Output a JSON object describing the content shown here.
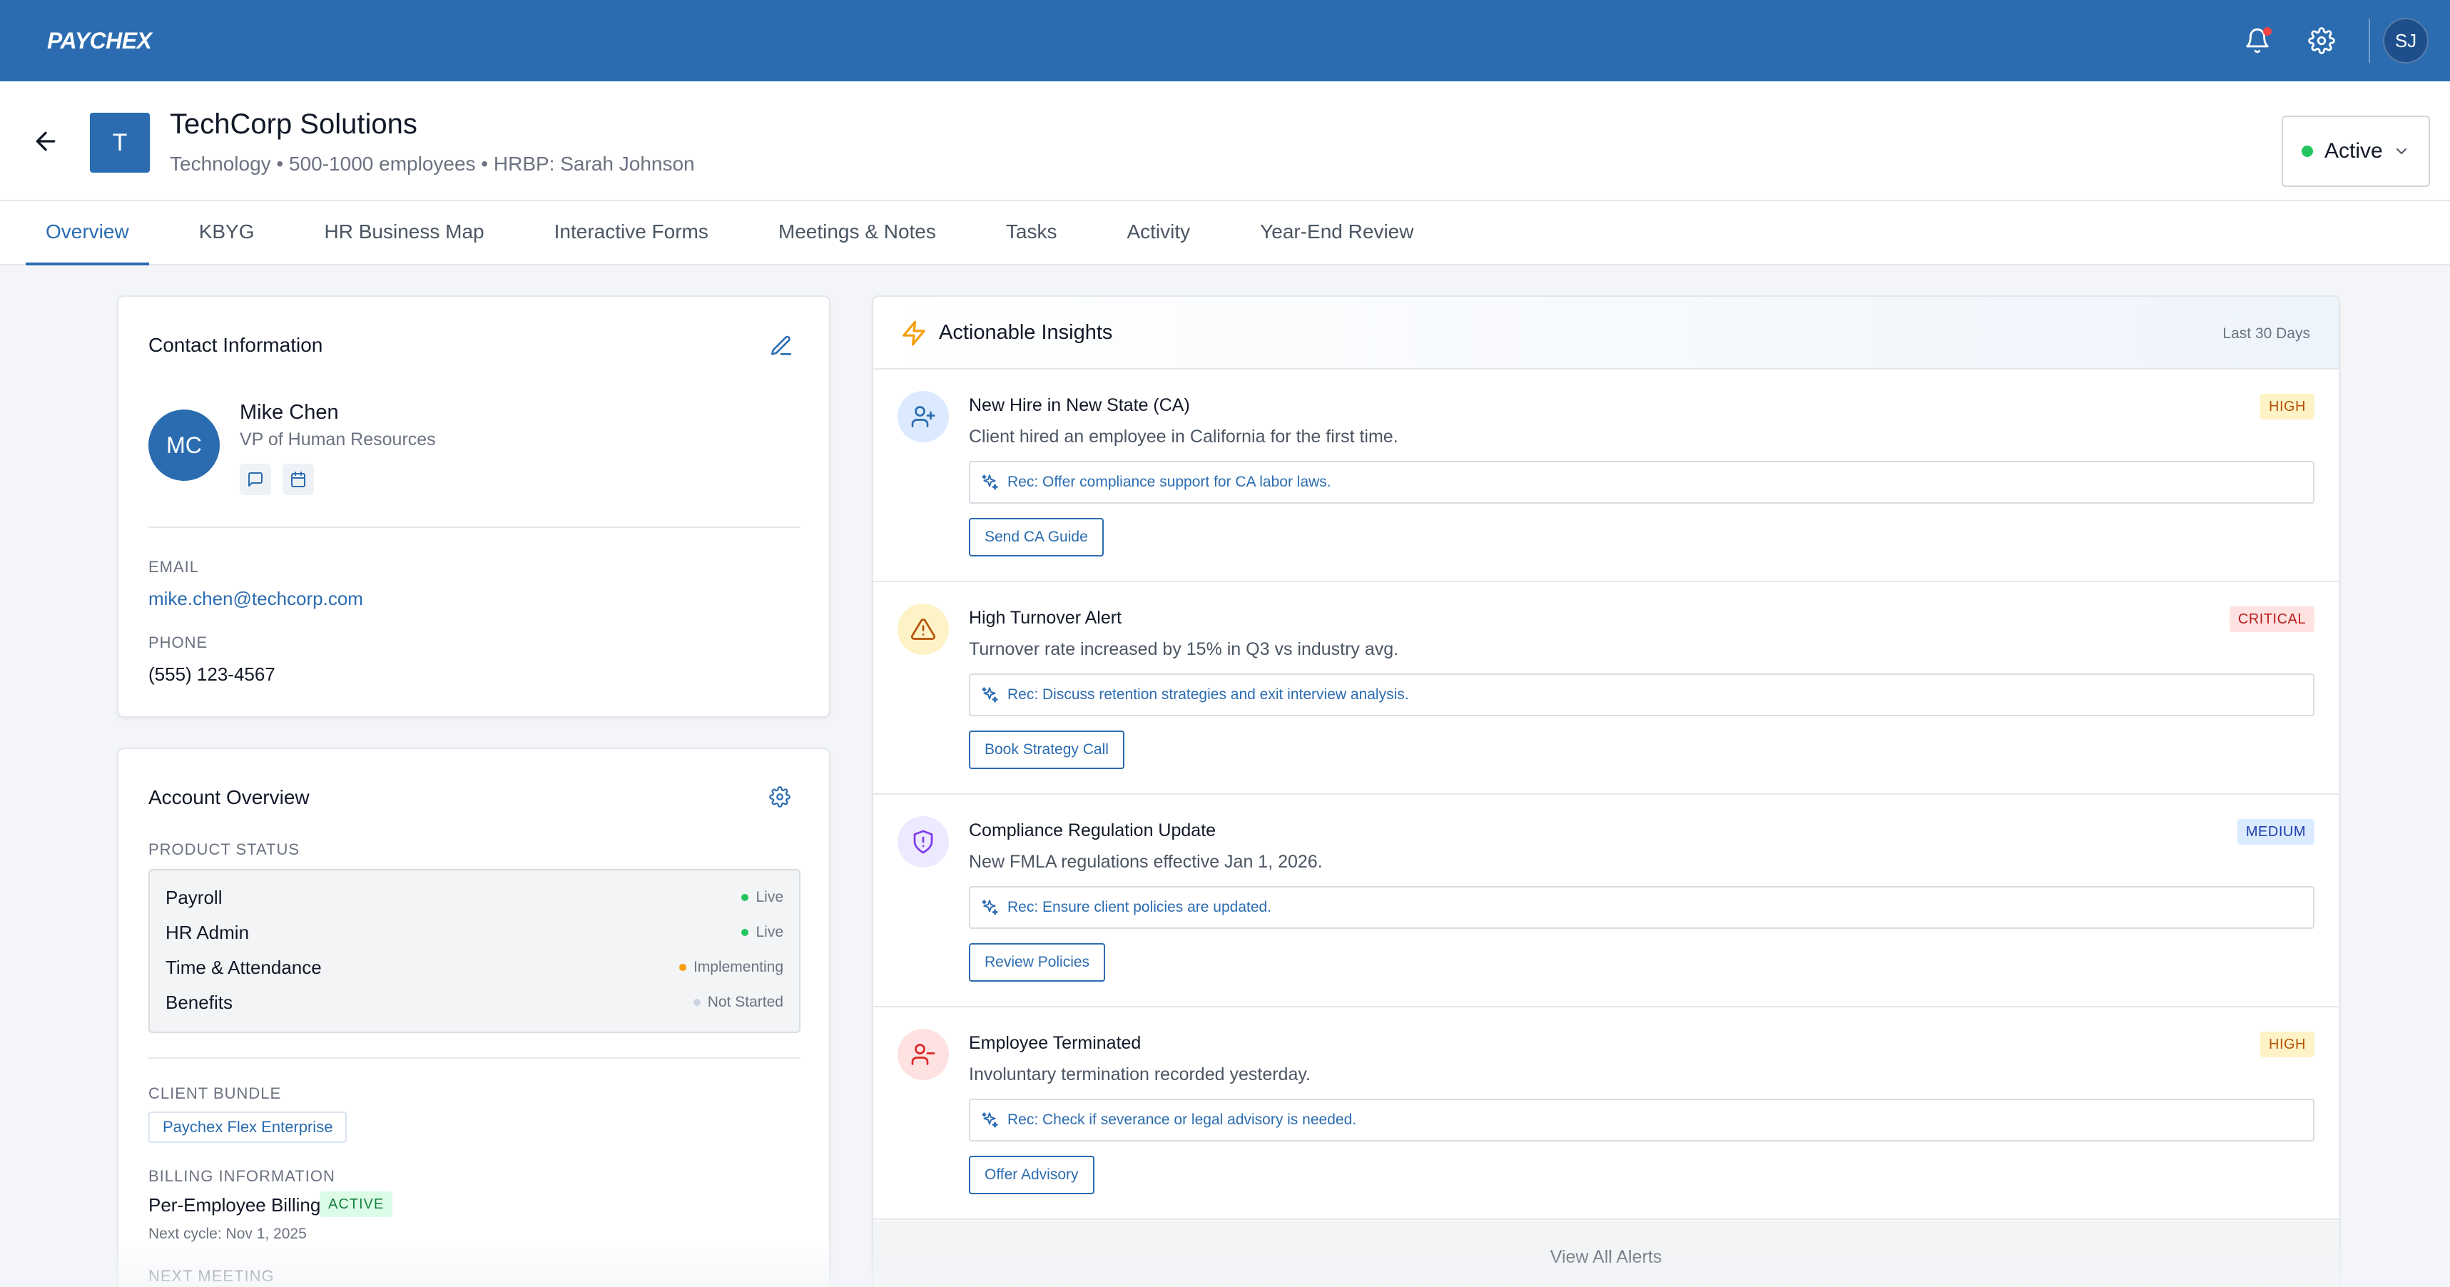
{
  "app": {
    "logo": "PAYCHEX"
  },
  "topbar": {
    "user_initials": "SJ",
    "has_notification": true
  },
  "client": {
    "logo_letter": "T",
    "name": "TechCorp Solutions",
    "meta": "Technology • 500-1000 employees • HRBP: Sarah Johnson",
    "status": "Active",
    "status_color": "#22c55e"
  },
  "tabs": [
    {
      "label": "Overview",
      "active": true
    },
    {
      "label": "KBYG"
    },
    {
      "label": "HR Business Map"
    },
    {
      "label": "Interactive Forms"
    },
    {
      "label": "Meetings & Notes"
    },
    {
      "label": "Tasks"
    },
    {
      "label": "Activity"
    },
    {
      "label": "Year-End Review"
    }
  ],
  "contact": {
    "title": "Contact Information",
    "initials": "MC",
    "name": "Mike Chen",
    "role": "VP of Human Resources",
    "email_label": "EMAIL",
    "email": "mike.chen@techcorp.com",
    "phone_label": "PHONE",
    "phone": "(555) 123-4567"
  },
  "account": {
    "title": "Account Overview",
    "product_status_label": "PRODUCT STATUS",
    "products": [
      {
        "name": "Payroll",
        "status": "Live",
        "color": "#22c55e"
      },
      {
        "name": "HR Admin",
        "status": "Live",
        "color": "#22c55e"
      },
      {
        "name": "Time & Attendance",
        "status": "Implementing",
        "color": "#f59e0b"
      },
      {
        "name": "Benefits",
        "status": "Not Started",
        "color": "#cbd5e1"
      }
    ],
    "bundle_label": "CLIENT BUNDLE",
    "bundle": "Paychex Flex Enterprise",
    "billing_label": "BILLING INFORMATION",
    "billing_type": "Per-Employee Billing",
    "billing_status": "ACTIVE",
    "next_cycle": "Next cycle: Nov 1, 2025",
    "next_meeting_label": "NEXT MEETING"
  },
  "insights": {
    "title": "Actionable Insights",
    "range": "Last 30 Days",
    "items": [
      {
        "icon": "user-plus-icon",
        "title": "New Hire in New State (CA)",
        "description": "Client hired an employee in California for the first time.",
        "severity": "HIGH",
        "recommendation": "Rec: Offer compliance support for CA labor laws.",
        "action": "Send CA Guide"
      },
      {
        "icon": "warning-triangle-icon",
        "title": "High Turnover Alert",
        "description": "Turnover rate increased by 15% in Q3 vs industry avg.",
        "severity": "CRITICAL",
        "recommendation": "Rec: Discuss retention strategies and exit interview analysis.",
        "action": "Book Strategy Call"
      },
      {
        "icon": "shield-alert-icon",
        "title": "Compliance Regulation Update",
        "description": "New FMLA regulations effective Jan 1, 2026.",
        "severity": "MEDIUM",
        "recommendation": "Rec: Ensure client policies are updated.",
        "action": "Review Policies"
      },
      {
        "icon": "user-minus-icon",
        "title": "Employee Terminated",
        "description": "Involuntary termination recorded yesterday.",
        "severity": "HIGH",
        "recommendation": "Rec: Check if severance or legal advisory is needed.",
        "action": "Offer Advisory"
      }
    ],
    "view_all": "View All Alerts"
  },
  "colors": {
    "brand": "#2b6cb0",
    "severity_high_bg": "#fef3c7",
    "severity_high_fg": "#b45309",
    "severity_critical_bg": "#fee2e2",
    "severity_critical_fg": "#b91c1c",
    "severity_medium_bg": "#dbeafe",
    "severity_medium_fg": "#1e40af"
  }
}
